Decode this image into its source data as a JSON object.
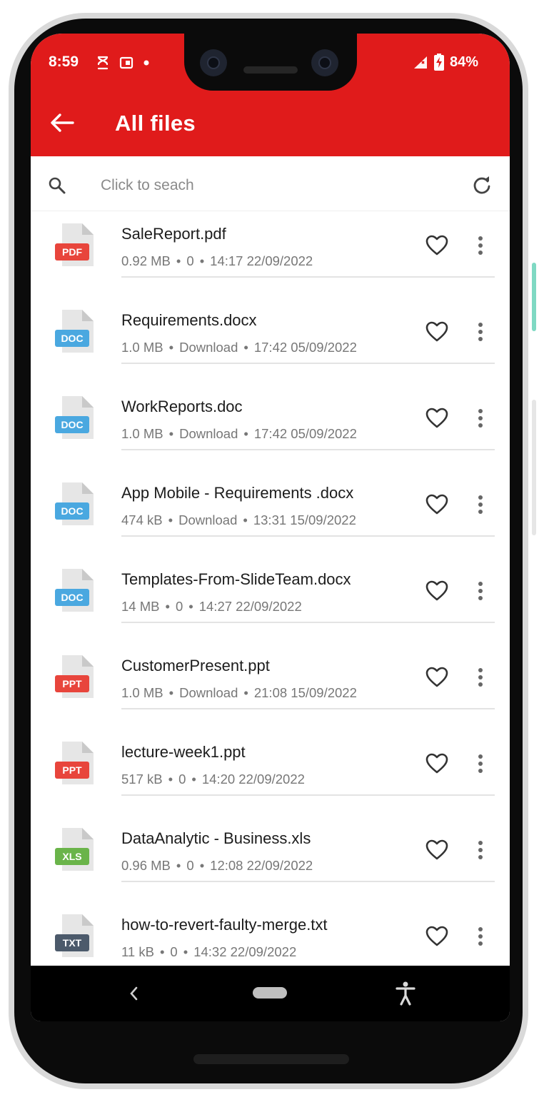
{
  "status_bar": {
    "time": "8:59",
    "battery": "84%"
  },
  "header": {
    "title": "All files"
  },
  "search": {
    "placeholder": "Click to seach"
  },
  "colors": {
    "accent": "#e01b1b",
    "pdf": "#e8453c",
    "doc": "#4aa8e0",
    "ppt": "#e8453c",
    "xls": "#6ab44a",
    "txt": "#4c5a6b"
  },
  "files": [
    {
      "name": "SaleReport.pdf",
      "size": "0.92 MB",
      "source": "0",
      "date": "14:17 22/09/2022",
      "type": "PDF"
    },
    {
      "name": "Requirements.docx",
      "size": "1.0 MB",
      "source": "Download",
      "date": "17:42 05/09/2022",
      "type": "DOC"
    },
    {
      "name": "WorkReports.doc",
      "size": "1.0 MB",
      "source": "Download",
      "date": "17:42 05/09/2022",
      "type": "DOC"
    },
    {
      "name": "App Mobile - Requirements .docx",
      "size": "474 kB",
      "source": "Download",
      "date": "13:31 15/09/2022",
      "type": "DOC"
    },
    {
      "name": "Templates-From-SlideTeam.docx",
      "size": "14 MB",
      "source": "0",
      "date": "14:27 22/09/2022",
      "type": "DOC"
    },
    {
      "name": "CustomerPresent.ppt",
      "size": "1.0 MB",
      "source": "Download",
      "date": "21:08 15/09/2022",
      "type": "PPT"
    },
    {
      "name": "lecture-week1.ppt",
      "size": "517 kB",
      "source": "0",
      "date": "14:20 22/09/2022",
      "type": "PPT"
    },
    {
      "name": "DataAnalytic - Business.xls",
      "size": "0.96 MB",
      "source": "0",
      "date": "12:08 22/09/2022",
      "type": "XLS"
    },
    {
      "name": "how-to-revert-faulty-merge.txt",
      "size": "11 kB",
      "source": "0",
      "date": "14:32 22/09/2022",
      "type": "TXT"
    }
  ]
}
